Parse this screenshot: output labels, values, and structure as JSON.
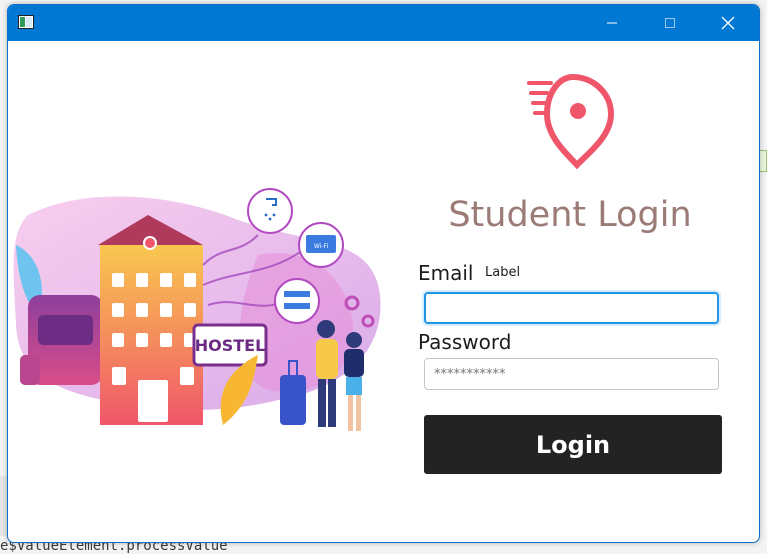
{
  "window": {
    "app_icon": "window-app-icon",
    "buttons": {
      "minimize": "minimize-icon",
      "maximize": "maximize-icon",
      "close": "close-icon"
    }
  },
  "background": {
    "code_line": "e$ValueElement.processValue"
  },
  "illustration": {
    "sign_text": "HOSTEL",
    "wifi_text": "Wi-Fi"
  },
  "login": {
    "logo_icon": "location-pin-icon",
    "title": "Student Login",
    "email_label": "Email",
    "email_extra_label": "Label",
    "email_value": "",
    "password_label": "Password",
    "password_placeholder": "***********",
    "login_button": "Login"
  },
  "colors": {
    "titlebar": "#0078d4",
    "accent_pink": "#f0566a",
    "title_text": "#9b7b76",
    "button_bg": "#232323",
    "focus_border": "#2196e6"
  }
}
